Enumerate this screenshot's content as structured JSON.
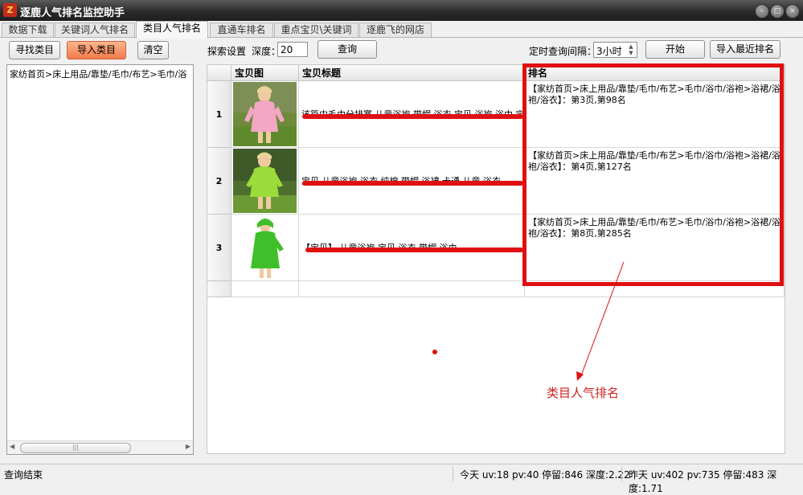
{
  "window": {
    "title": "逐鹿人气排名监控助手",
    "icon_label": "Z",
    "controls": [
      "minimize-icon",
      "maximize-icon",
      "close-icon"
    ]
  },
  "tabs": [
    {
      "label": "数据下载",
      "active": false
    },
    {
      "label": "关键词人气排名",
      "active": false
    },
    {
      "label": "类目人气排名",
      "active": true
    },
    {
      "label": "直通车排名",
      "active": false
    },
    {
      "label": "重点宝贝\\关键词",
      "active": false
    },
    {
      "label": "逐鹿飞的网店",
      "active": false
    }
  ],
  "toolbar": {
    "find_category": "寻找类目",
    "import_category": "导入类目",
    "clear": "清空",
    "search_settings": "探索设置",
    "depth_label": "深度：",
    "depth_value": "20",
    "query": "查询",
    "interval_label": "定时查询间隔：",
    "interval_value": "3小时",
    "start": "开始",
    "import_recent": "导入最近排名"
  },
  "category_panel": {
    "path": "家纺首页>床上用品/靠垫/毛巾/布艺>毛巾/浴"
  },
  "grid": {
    "headers": {
      "image": "宝贝图",
      "title": "宝贝标题",
      "rank": "排名"
    },
    "rows": [
      {
        "index": "1",
        "title": "该篇中毛巾分排寒 儿童浴袍 带帽 浴衣 宝贝 浴袍 浴巾 宝贝 浴袍",
        "rank": "【家纺首页>床上用品/靠垫/毛巾/布艺>毛巾/浴巾/浴袍>浴裙/浴袍/浴衣】：第3页,第98名"
      },
      {
        "index": "2",
        "title": "宝贝 儿童浴袍 浴衣 纯棉 带帽 浴裙 卡通 儿童 浴衣",
        "rank": "【家纺首页>床上用品/靠垫/毛巾/布艺>毛巾/浴巾/浴袍>浴裙/浴袍/浴衣】：第4页,第127名"
      },
      {
        "index": "3",
        "title": "【宝贝】 儿童浴袍 宝贝 浴衣 带帽 浴巾",
        "rank": "【家纺首页>床上用品/靠垫/毛巾/布艺>毛巾/浴巾/浴袍>浴裙/浴袍/浴衣】：第8页,第285名"
      }
    ]
  },
  "annotation": {
    "label": "类目人气排名",
    "color": "#e01010"
  },
  "status": {
    "message": "查询结束",
    "today": "今天 uv:18 pv:40 停留:846 深度:2.22",
    "yesterday": "昨天 uv:402 pv:735 停留:483 深度:1.71"
  }
}
